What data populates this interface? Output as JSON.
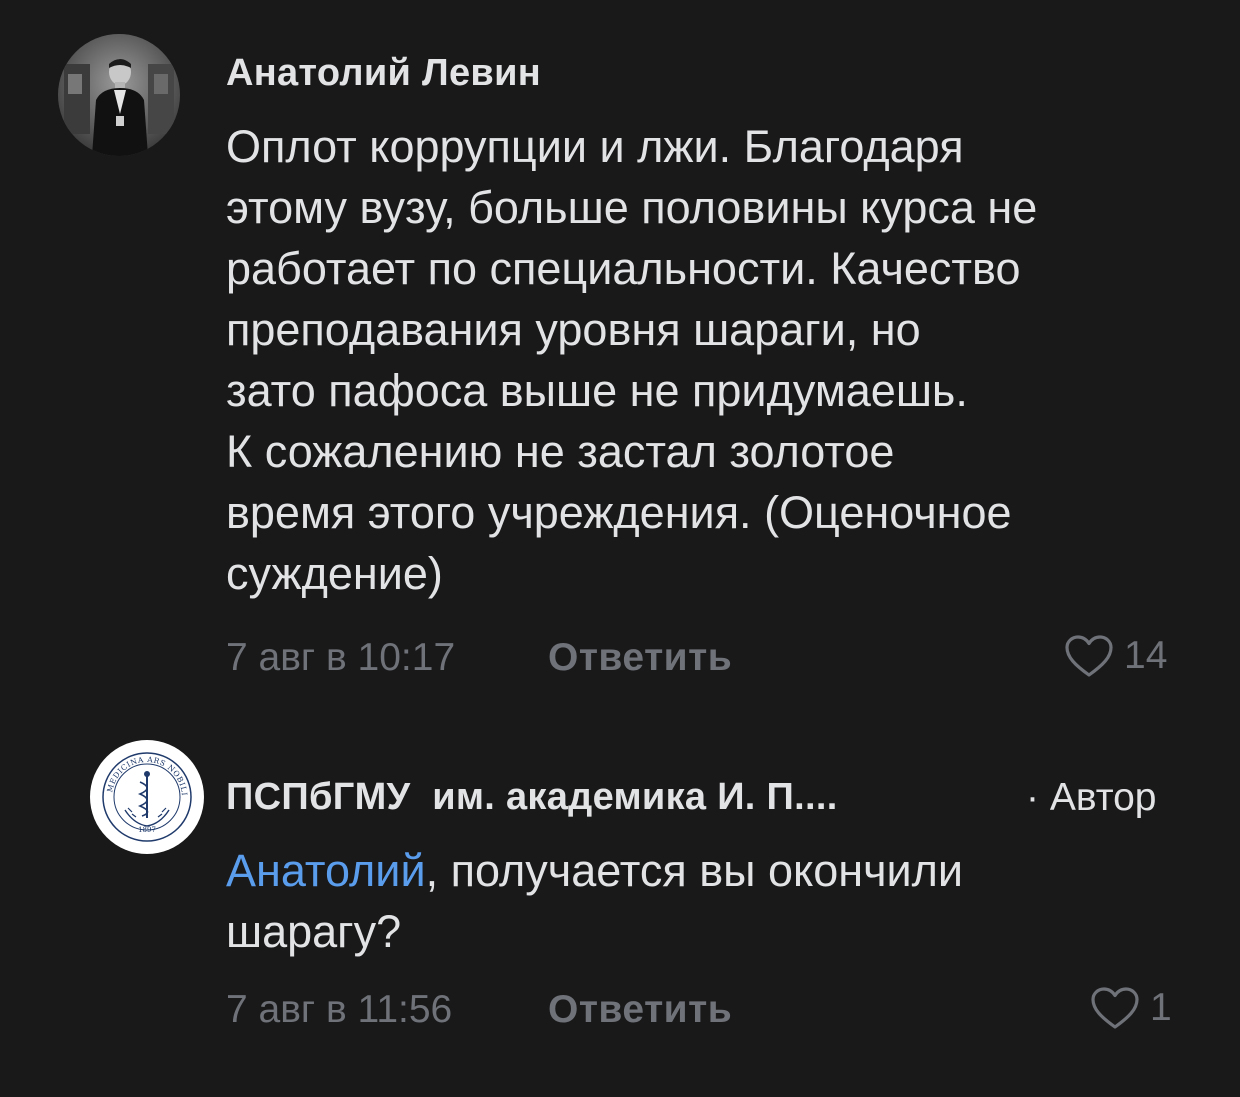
{
  "comments": [
    {
      "author": "Анатолий Левин",
      "text": "Оплот коррупции и лжи. Благодаря\nэтому вузу, больше половины курса не\nработает по специальности. Качество\nпреподавания уровня шараги, но\nзато пафоса выше не придумаешь.\nК сожалению не застал золотое\nвремя этого учреждения. (Оценочное\nсуждение)",
      "time": "7 авг в 10:17",
      "reply_label": "Ответить",
      "likes": "14",
      "avatar_icon": "user-photo"
    },
    {
      "author": "ПСПбГМУ  им. академика И. П....",
      "author_tag": "· Автор",
      "mention": "Анатолий",
      "text": ", получается вы окончили\nшарагу?",
      "time": "7 авг в 11:56",
      "reply_label": "Ответить",
      "likes": "1",
      "avatar_icon": "university-seal",
      "seal_text": "MEDICINA ARS NOBILISSIMA",
      "seal_year": "1897"
    }
  ],
  "colors": {
    "background": "#19191a",
    "text": "#e2e3e5",
    "secondary": "#6f7278",
    "mention": "#5b9ded"
  }
}
